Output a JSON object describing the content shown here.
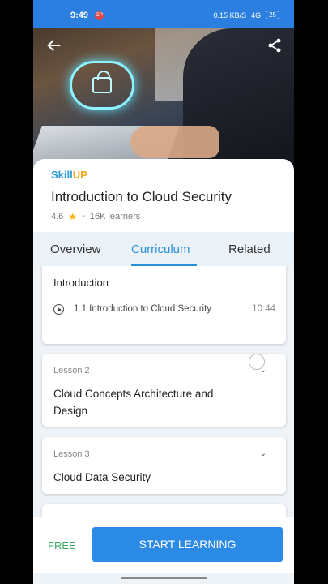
{
  "status": {
    "time": "9:49",
    "rec": "GP",
    "net": "0.15 KB/S",
    "signal": "4G",
    "battery": "25"
  },
  "hero": {
    "back_icon": "arrow-left-icon",
    "share_icon": "share-icon"
  },
  "course": {
    "brand_a": "Skill",
    "brand_b": "UP",
    "title": "Introduction to Cloud Security",
    "rating": "4.6",
    "learners": "16K learners"
  },
  "tabs": {
    "overview": "Overview",
    "curriculum": "Curriculum",
    "related": "Related",
    "active": "Curriculum"
  },
  "curriculum": {
    "intro": {
      "heading": "Introduction",
      "item_label": "1.1 Introduction to Cloud Security",
      "item_duration": "10:44"
    },
    "lessons": [
      {
        "label": "Lesson 2",
        "title": "Cloud Concepts Architecture and Design"
      },
      {
        "label": "Lesson 3",
        "title": "Cloud Data Security"
      }
    ]
  },
  "footer": {
    "price": "FREE",
    "cta": "START LEARNING"
  },
  "colors": {
    "accent": "#2b8ae6",
    "free": "#3bab63",
    "brand": "#2a9bd6",
    "star": "#f5b400"
  }
}
